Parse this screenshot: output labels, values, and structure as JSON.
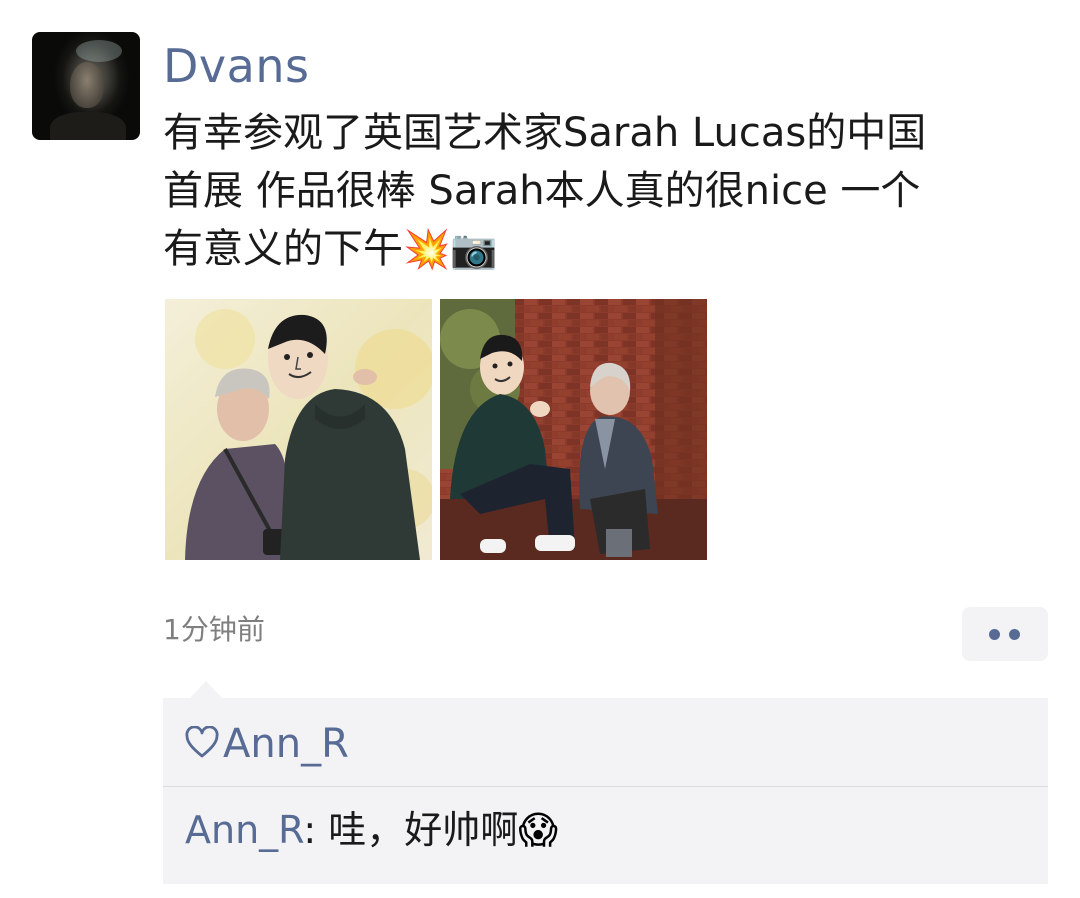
{
  "post": {
    "author": "Dvans",
    "text_line1": "有幸参观了英国艺术家Sarah Lucas的中国",
    "text_line2": "首展  作品很棒 Sarah本人真的很nice 一个",
    "text_line3": "有意义的下午",
    "emoji": "💥📷",
    "timestamp": "1分钟前",
    "images": [
      "photo-1",
      "photo-2"
    ]
  },
  "likes": {
    "icon": "heart-icon",
    "names": "Ann_R"
  },
  "comments": [
    {
      "author": "Ann_R",
      "separator": ": ",
      "text": "哇，好帅啊",
      "emoji": "😱"
    }
  ],
  "colors": {
    "link": "#576b95",
    "panel": "#f3f3f5",
    "text": "#1a1a1a",
    "muted": "#7f7f7f"
  }
}
